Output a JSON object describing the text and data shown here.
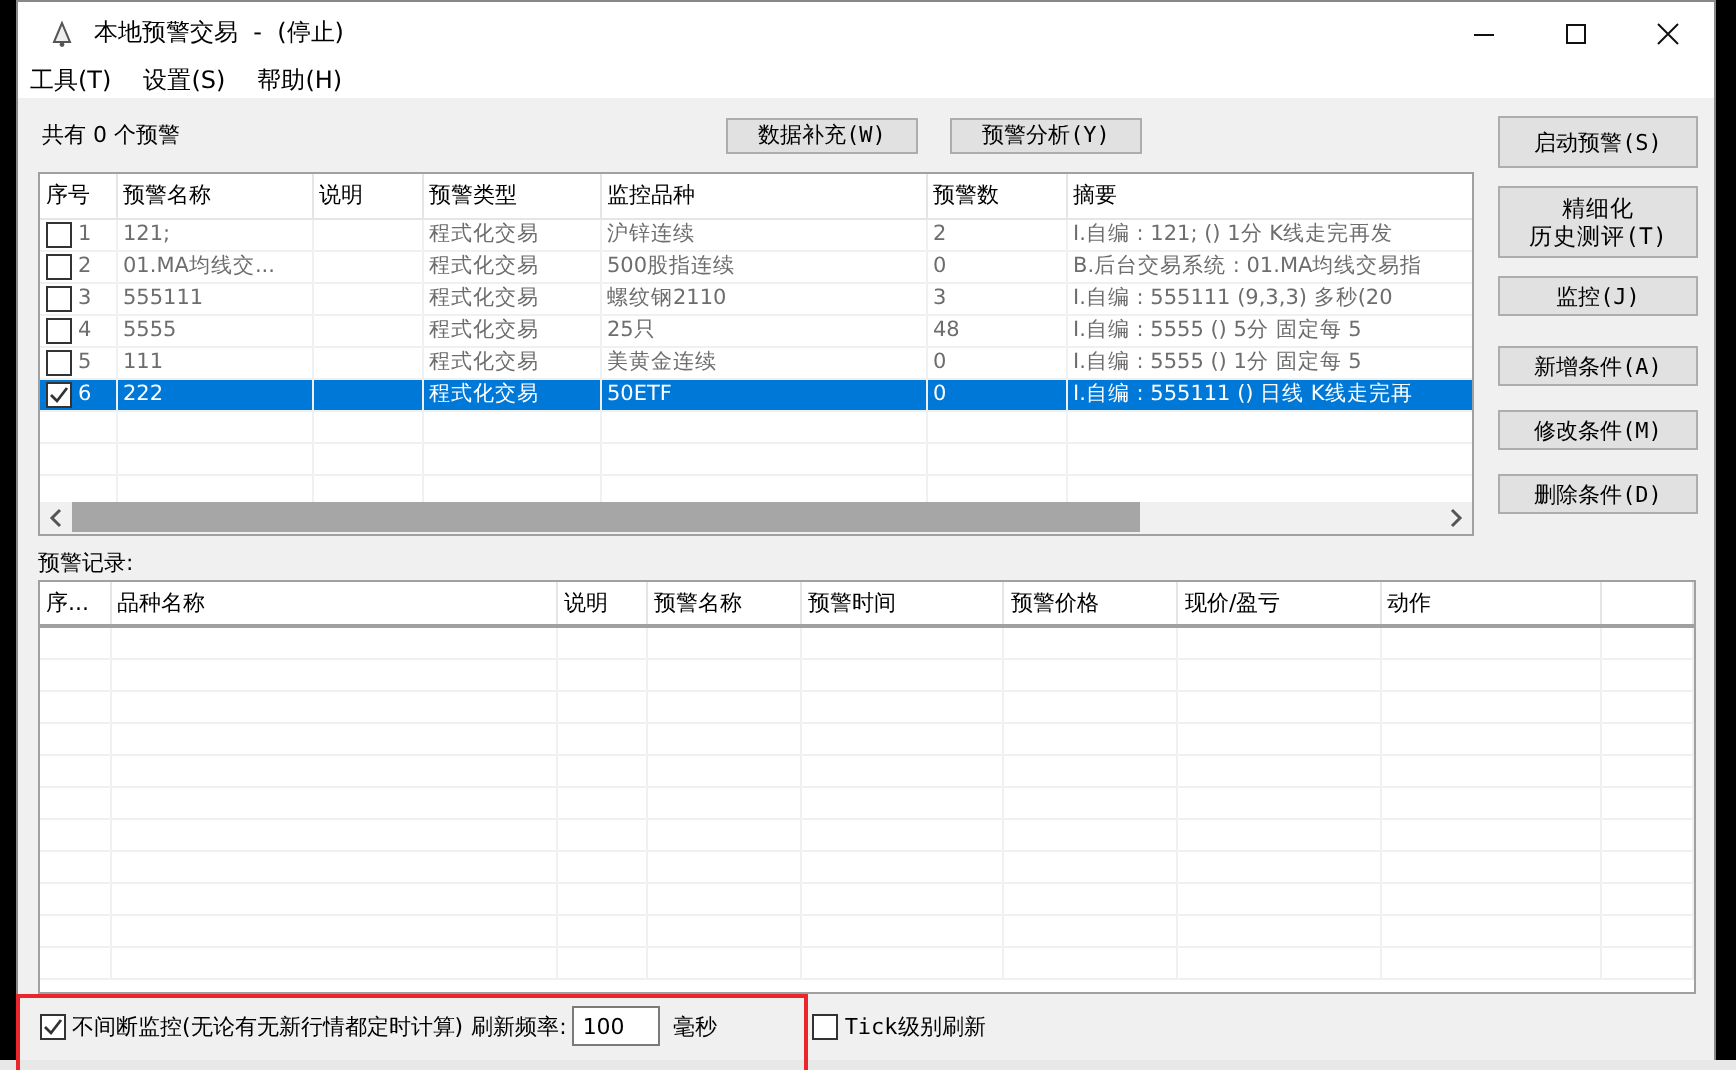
{
  "window": {
    "title": "本地预警交易  -  (停止)"
  },
  "menu": [
    "工具(T)",
    "设置(S)",
    "帮助(H)"
  ],
  "count_label": "共有 0 个预警",
  "toolbar_buttons": [
    "数据补充(W)",
    "预警分析(Y)"
  ],
  "alerts": {
    "columns": [
      "序号",
      "预警名称",
      "说明",
      "预警类型",
      "监控品种",
      "预警数",
      "摘要"
    ],
    "rows": [
      {
        "checked": false,
        "selected": false,
        "number": "1",
        "name": "121;",
        "type": "程式化交易",
        "symbol": "沪锌连续",
        "count": "2",
        "summary": "I.自编 : 121; () 1分 K线走完再发"
      },
      {
        "checked": false,
        "selected": false,
        "number": "2",
        "name": "01.MA均线交...",
        "type": "程式化交易",
        "symbol": "500股指连续",
        "count": "0",
        "summary": "B.后台交易系统 : 01.MA均线交易指"
      },
      {
        "checked": false,
        "selected": false,
        "number": "3",
        "name": "555111",
        "type": "程式化交易",
        "symbol": "螺纹钢2110",
        "count": "3",
        "summary": "I.自编 : 555111 (9,3,3) 多秒(20"
      },
      {
        "checked": false,
        "selected": false,
        "number": "4",
        "name": "5555",
        "type": "程式化交易",
        "symbol": "25只",
        "count": "48",
        "summary": "I.自编 : 5555 () 5分 固定每 5"
      },
      {
        "checked": false,
        "selected": false,
        "number": "5",
        "name": "111",
        "type": "程式化交易",
        "symbol": "美黄金连续",
        "count": "0",
        "summary": "I.自编 : 5555 () 1分 固定每 5"
      },
      {
        "checked": true,
        "selected": true,
        "number": "6",
        "name": "222",
        "type": "程式化交易",
        "symbol": "50ETF",
        "count": "0",
        "summary": "I.自编 : 555111 () 日线 K线走完再"
      }
    ]
  },
  "side_buttons": [
    {
      "label": "启动预警(S)",
      "kind": "normal"
    },
    {
      "lines": [
        "精细化",
        "历史测评(T)"
      ],
      "kind": "tall"
    },
    {
      "label": "监控(J)",
      "kind": "normal"
    },
    {
      "label": "新增条件(A)",
      "kind": "normal"
    },
    {
      "label": "修改条件(M)",
      "kind": "normal"
    },
    {
      "label": "删除条件(D)",
      "kind": "normal"
    }
  ],
  "records_label": "预警记录:",
  "records": {
    "columns": [
      "序...",
      "品种名称",
      "说明",
      "预警名称",
      "预警时间",
      "预警价格",
      "现价/盈亏",
      "动作"
    ]
  },
  "bottom": {
    "continuous": {
      "label": "不间断监控(无论有无新行情都定时计算)",
      "checked": true
    },
    "refresh_label": "刷新频率:",
    "refresh_value": "100",
    "unit": "毫秒",
    "tick": {
      "label": "Tick级别刷新",
      "checked": false
    }
  }
}
